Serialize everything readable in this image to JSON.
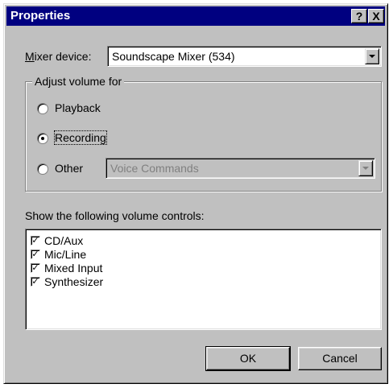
{
  "window": {
    "title": "Properties",
    "help_label": "?",
    "close_label": "X"
  },
  "mixer": {
    "label_accel": "M",
    "label_rest": "ixer device:",
    "selected": "Soundscape Mixer (534)"
  },
  "adjust_group": {
    "legend": "Adjust volume for",
    "options": [
      {
        "label": "Playback",
        "checked": false
      },
      {
        "label": "Recording",
        "checked": true
      },
      {
        "label": "Other",
        "checked": false
      }
    ],
    "other_select": {
      "value": "Voice Commands",
      "enabled": false
    }
  },
  "controls": {
    "label": "Show the following volume controls:",
    "items": [
      {
        "label": "CD/Aux",
        "checked": true
      },
      {
        "label": "Mic/Line",
        "checked": true
      },
      {
        "label": "Mixed Input",
        "checked": true
      },
      {
        "label": "Synthesizer",
        "checked": true
      }
    ]
  },
  "buttons": {
    "ok": "OK",
    "cancel": "Cancel"
  },
  "colors": {
    "titlebar": "#000080",
    "face": "#c0c0c0",
    "disabled_text": "#808080"
  },
  "icons": {
    "help": "help-icon",
    "close": "close-icon",
    "dropdown": "chevron-down-icon",
    "check": "checkmark-icon"
  }
}
